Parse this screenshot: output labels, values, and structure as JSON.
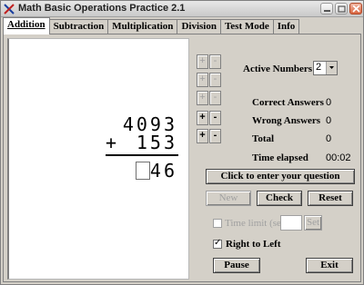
{
  "window": {
    "title": "Math Basic Operations Practice 2.1",
    "icon": "math-app-icon"
  },
  "tabs": [
    {
      "label": "Addition",
      "active": true
    },
    {
      "label": "Subtraction",
      "active": false
    },
    {
      "label": "Multiplication",
      "active": false
    },
    {
      "label": "Division",
      "active": false
    },
    {
      "label": "Test Mode",
      "active": false
    },
    {
      "label": "Info",
      "active": false
    }
  ],
  "problem": {
    "number1": "4093",
    "number2": "153",
    "operator": "+",
    "answer_digits": "46"
  },
  "digit_buttons": {
    "plus": "+",
    "minus": "-"
  },
  "settings": {
    "active_numbers_label": "Active  Numbers",
    "active_numbers_value": "2"
  },
  "stats": {
    "correct_label": "Correct Answers",
    "correct_value": "0",
    "wrong_label": "Wrong Answers",
    "wrong_value": "0",
    "total_label": "Total",
    "total_value": "0",
    "elapsed_label": "Time elapsed",
    "elapsed_value": "00:02"
  },
  "buttons": {
    "enter_question": "Click to enter your question",
    "new": "New",
    "check": "Check",
    "reset": "Reset",
    "set": "Set",
    "pause": "Pause",
    "exit": "Exit"
  },
  "options": {
    "time_limit_label": "Time limit (sec)",
    "time_limit_value": "",
    "right_to_left_label": "Right to Left",
    "right_to_left_checked": true
  }
}
